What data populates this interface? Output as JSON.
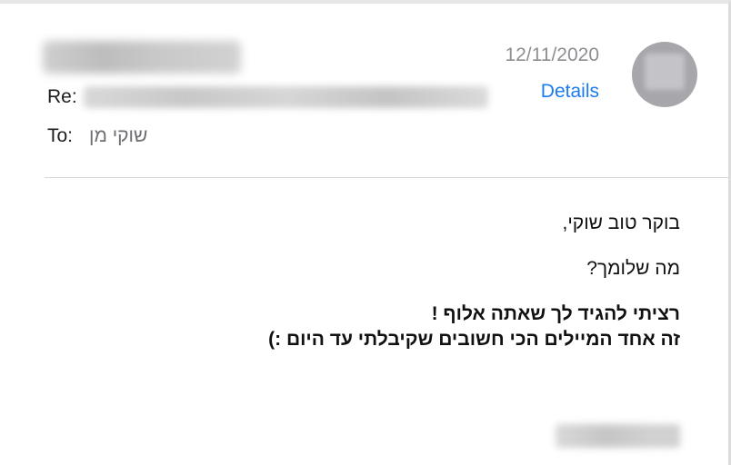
{
  "header": {
    "re_label": "Re:",
    "to_label": "To:",
    "to_value": "שוקי מן",
    "date": "12/11/2020",
    "details_label": "Details"
  },
  "message": {
    "greeting": "בוקר טוב שוקי,",
    "question": "מה שלומך?",
    "bold_line_1": "רציתי להגיד לך שאתה אלוף !",
    "bold_line_2": "זה אחד המיילים הכי חשובים שקיבלתי עד היום :)"
  }
}
